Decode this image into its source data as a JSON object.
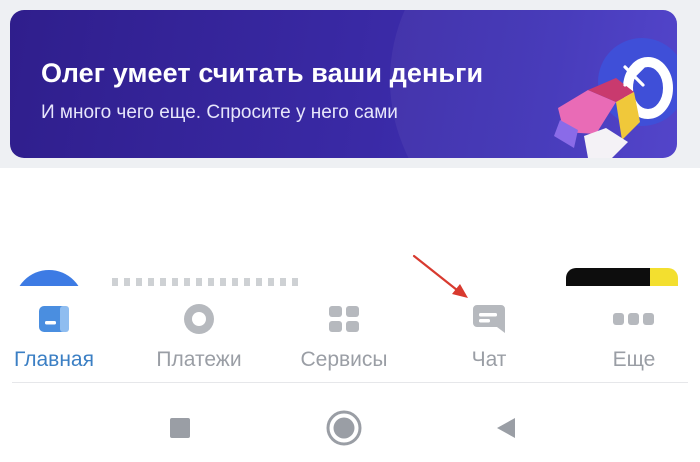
{
  "promo": {
    "title": "Олег умеет считать ваши деньги",
    "subtitle": "И много чего еще. Спросите у него сами",
    "close_icon": "close-icon",
    "background": "#3a2aa6"
  },
  "tabbar": {
    "accent_color": "#3b7fc4",
    "inactive_color": "#9a9ea5",
    "items": [
      {
        "label": "Главная",
        "icon": "home-card-icon",
        "active": true
      },
      {
        "label": "Платежи",
        "icon": "payments-circle-icon",
        "active": false
      },
      {
        "label": "Сервисы",
        "icon": "services-grid-icon",
        "active": false
      },
      {
        "label": "Чат",
        "icon": "chat-bubble-icon",
        "active": false
      },
      {
        "label": "Еще",
        "icon": "more-dots-icon",
        "active": false
      }
    ]
  },
  "system_nav": {
    "items": [
      "recents-square-icon",
      "home-circle-icon",
      "back-triangle-icon"
    ]
  }
}
